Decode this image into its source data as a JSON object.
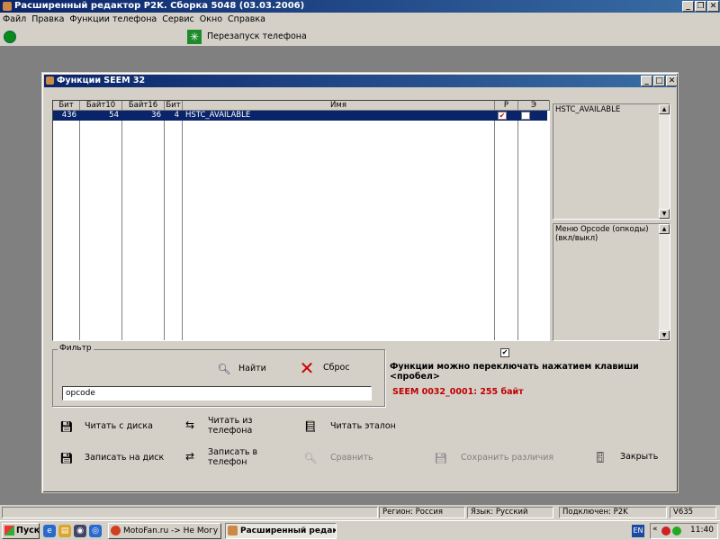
{
  "app": {
    "title": "Расширенный редактор P2K. Сборка 5048 (03.03.2006)",
    "window_buttons": [
      "_",
      "❐",
      "✕"
    ]
  },
  "menu": [
    "Файл",
    "Правка",
    "Функции телефона",
    "Сервис",
    "Окно",
    "Справка"
  ],
  "toolbar": {
    "restart_label": "Перезапуск телефона"
  },
  "dialog": {
    "title": "Функции SEEM 32",
    "window_buttons": [
      "_",
      "□",
      "✕"
    ],
    "table": {
      "columns": [
        "Бит",
        "Байт10",
        "Байт16",
        "Бит",
        "Имя",
        "Р",
        "Э"
      ],
      "rows": [
        {
          "bit": "436",
          "byte10": "54",
          "byte16": "36",
          "bit2": "4",
          "name": "HSTC_AVAILABLE",
          "p": true,
          "e": false
        }
      ]
    },
    "info_top": "HSTC_AVAILABLE",
    "info_bottom": "Меню Opcode (опкоды) (вкл/выкл)",
    "filter": {
      "legend": "Фильтр",
      "find_label": "Найти",
      "reset_label": "Сброс",
      "value": "opcode"
    },
    "toggle_checked": true,
    "hint": "Функции можно переключать нажатием клавиши <пробел>",
    "seem_info": "SEEM 0032_0001: 255 байт",
    "buttons": {
      "read_disk": "Читать с диска",
      "read_phone": "Читать из телефона",
      "read_ref": "Читать эталон",
      "write_disk": "Записать на диск",
      "write_phone": "Записать в телефон",
      "compare": "Сравнить",
      "save_diff": "Сохранить различия",
      "close": "Закрыть"
    }
  },
  "statusbar": {
    "region": "Регион: Россия",
    "language": "Язык: Русский",
    "connection": "Подключен: P2K",
    "model": "V635"
  },
  "taskbar": {
    "start": "Пуск",
    "tasks": [
      "MotoFan.ru -> Не Могу ...",
      "Расширенный редак..."
    ],
    "lang": "EN",
    "time": "11:40"
  }
}
